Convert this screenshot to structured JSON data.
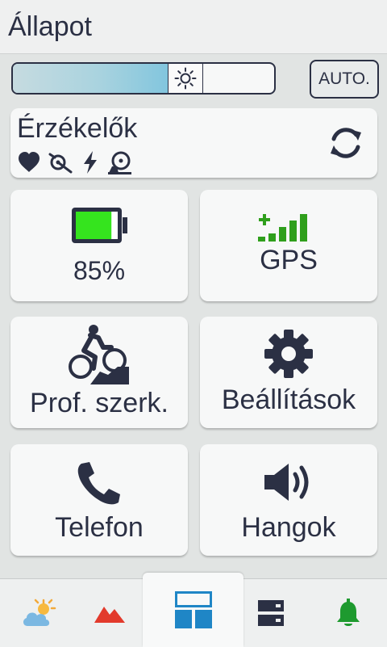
{
  "header": {
    "title": "Állapot"
  },
  "brightness": {
    "level_percent": 66,
    "auto_label": "AUTO."
  },
  "sensors": {
    "label": "Érzékelők",
    "icons": [
      "heart-icon",
      "cadence-sensor-icon",
      "power-icon",
      "speed-sensor-icon"
    ]
  },
  "tiles": {
    "battery": {
      "label": "85%",
      "level_percent": 85,
      "fill_color": "#35e41e"
    },
    "gps": {
      "label": "GPS",
      "signal_color": "#2f9f1c"
    },
    "profile": {
      "label": "Prof. szerk."
    },
    "settings": {
      "label": "Beállítások"
    },
    "phone": {
      "label": "Telefon"
    },
    "sounds": {
      "label": "Hangok"
    }
  },
  "navbar": {
    "items": [
      {
        "icon": "weather-icon"
      },
      {
        "icon": "elevation-icon"
      },
      {
        "icon": "dashboard-icon",
        "active": true
      },
      {
        "icon": "storage-icon"
      },
      {
        "icon": "notification-bell-icon"
      }
    ]
  },
  "colors": {
    "accent_blue": "#1f86c6",
    "text": "#2b3044",
    "gps_green": "#2f9f1c",
    "bell_green": "#1e9a2f",
    "elevation_red": "#e23a2c"
  }
}
